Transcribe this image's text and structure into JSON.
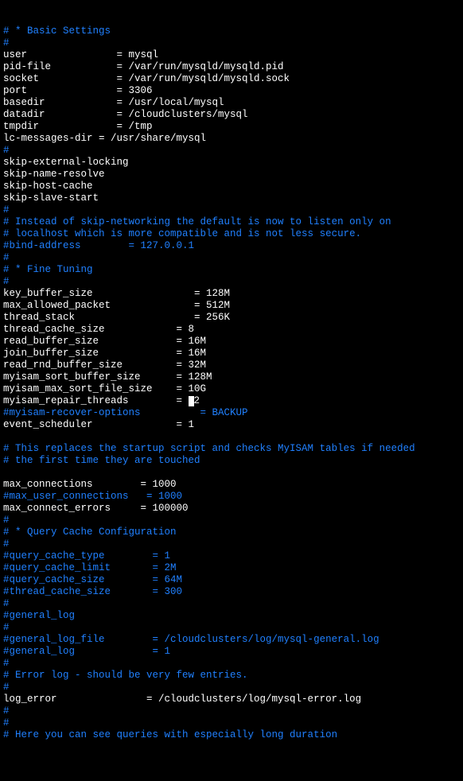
{
  "lines": [
    {
      "cls": "c",
      "text": "# * Basic Settings"
    },
    {
      "cls": "c",
      "text": "#"
    },
    {
      "cls": "w",
      "text": "user               = mysql"
    },
    {
      "cls": "w",
      "text": "pid-file           = /var/run/mysqld/mysqld.pid"
    },
    {
      "cls": "w",
      "text": "socket             = /var/run/mysqld/mysqld.sock"
    },
    {
      "cls": "w",
      "text": "port               = 3306"
    },
    {
      "cls": "w",
      "text": "basedir            = /usr/local/mysql"
    },
    {
      "cls": "w",
      "text": "datadir            = /cloudclusters/mysql"
    },
    {
      "cls": "w",
      "text": "tmpdir             = /tmp"
    },
    {
      "cls": "w",
      "text": "lc-messages-dir = /usr/share/mysql"
    },
    {
      "cls": "c",
      "text": "#"
    },
    {
      "cls": "w",
      "text": "skip-external-locking"
    },
    {
      "cls": "w",
      "text": "skip-name-resolve"
    },
    {
      "cls": "w",
      "text": "skip-host-cache"
    },
    {
      "cls": "w",
      "text": "skip-slave-start"
    },
    {
      "cls": "c",
      "text": "#"
    },
    {
      "cls": "c",
      "text": "# Instead of skip-networking the default is now to listen only on"
    },
    {
      "cls": "c",
      "text": "# localhost which is more compatible and is not less secure."
    },
    {
      "cls": "c",
      "text": "#bind-address        = 127.0.0.1"
    },
    {
      "cls": "c",
      "text": "#"
    },
    {
      "cls": "c",
      "text": "# * Fine Tuning"
    },
    {
      "cls": "c",
      "text": "#"
    },
    {
      "cls": "w",
      "text": "key_buffer_size                 = 128M"
    },
    {
      "cls": "w",
      "text": "max_allowed_packet              = 512M"
    },
    {
      "cls": "w",
      "text": "thread_stack                    = 256K"
    },
    {
      "cls": "w",
      "text": "thread_cache_size            = 8"
    },
    {
      "cls": "w",
      "text": "read_buffer_size             = 16M"
    },
    {
      "cls": "w",
      "text": "join_buffer_size             = 16M"
    },
    {
      "cls": "w",
      "text": "read_rnd_buffer_size         = 32M"
    },
    {
      "cls": "w",
      "text": "myisam_sort_buffer_size      = 128M"
    },
    {
      "cls": "w",
      "text": "myisam_max_sort_file_size    = 10G"
    },
    {
      "cls": "w",
      "text": "myisam_repair_threads        = ",
      "cursor": true,
      "after": "2"
    },
    {
      "cls": "c",
      "text": "#myisam-recover-options          = BACKUP"
    },
    {
      "cls": "w",
      "text": "event_scheduler              = 1"
    },
    {
      "cls": "w",
      "text": ""
    },
    {
      "cls": "c",
      "text": "# This replaces the startup script and checks MyISAM tables if needed"
    },
    {
      "cls": "c",
      "text": "# the first time they are touched"
    },
    {
      "cls": "w",
      "text": ""
    },
    {
      "cls": "w",
      "text": "max_connections        = 1000"
    },
    {
      "cls": "c",
      "text": "#max_user_connections   = 1000"
    },
    {
      "cls": "w",
      "text": "max_connect_errors     = 100000"
    },
    {
      "cls": "c",
      "text": "#"
    },
    {
      "cls": "c",
      "text": "# * Query Cache Configuration"
    },
    {
      "cls": "c",
      "text": "#"
    },
    {
      "cls": "c",
      "text": "#query_cache_type        = 1"
    },
    {
      "cls": "c",
      "text": "#query_cache_limit       = 2M"
    },
    {
      "cls": "c",
      "text": "#query_cache_size        = 64M"
    },
    {
      "cls": "c",
      "text": "#thread_cache_size       = 300"
    },
    {
      "cls": "c",
      "text": "#"
    },
    {
      "cls": "c",
      "text": "#general_log"
    },
    {
      "cls": "c",
      "text": "#"
    },
    {
      "cls": "c",
      "text": "#general_log_file        = /cloudclusters/log/mysql-general.log"
    },
    {
      "cls": "c",
      "text": "#general_log             = 1"
    },
    {
      "cls": "c",
      "text": "#"
    },
    {
      "cls": "c",
      "text": "# Error log - should be very few entries."
    },
    {
      "cls": "c",
      "text": "#"
    },
    {
      "cls": "w",
      "text": "log_error               = /cloudclusters/log/mysql-error.log"
    },
    {
      "cls": "c",
      "text": "#"
    },
    {
      "cls": "c",
      "text": "#"
    },
    {
      "cls": "c",
      "text": "# Here you can see queries with especially long duration"
    }
  ]
}
